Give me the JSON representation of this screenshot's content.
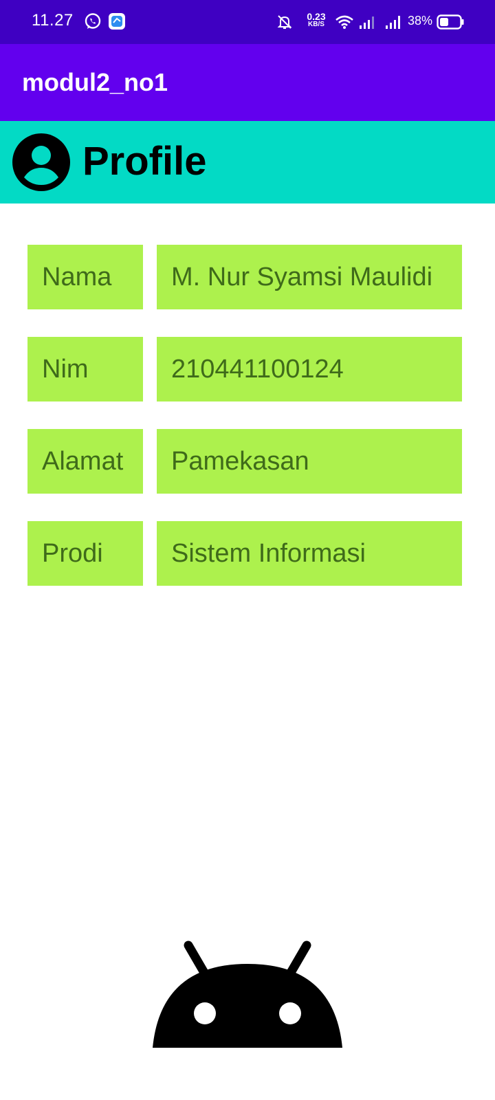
{
  "status_bar": {
    "time": "11.27",
    "net_speed_value": "0.23",
    "net_speed_unit": "KB/S",
    "battery_percent": "38%",
    "icons": [
      "whatsapp-icon",
      "app-notification-icon",
      "mute-bell-icon",
      "wifi-icon",
      "signal-icon",
      "signal-icon-2",
      "battery-icon"
    ]
  },
  "app_bar": {
    "title": "modul2_no1",
    "color": "#6200ee"
  },
  "profile_header": {
    "title": "Profile",
    "icon": "account-circle-icon",
    "color": "#03dac5"
  },
  "rows": [
    {
      "label": "Nama",
      "value": "M. Nur Syamsi Maulidi"
    },
    {
      "label": "Nim",
      "value": "210441100124"
    },
    {
      "label": "Alamat",
      "value": "Pamekasan"
    },
    {
      "label": "Prodi",
      "value": "Sistem Informasi"
    }
  ],
  "row_color": "#adf14d",
  "footer": {
    "icon": "android-logo-icon"
  }
}
